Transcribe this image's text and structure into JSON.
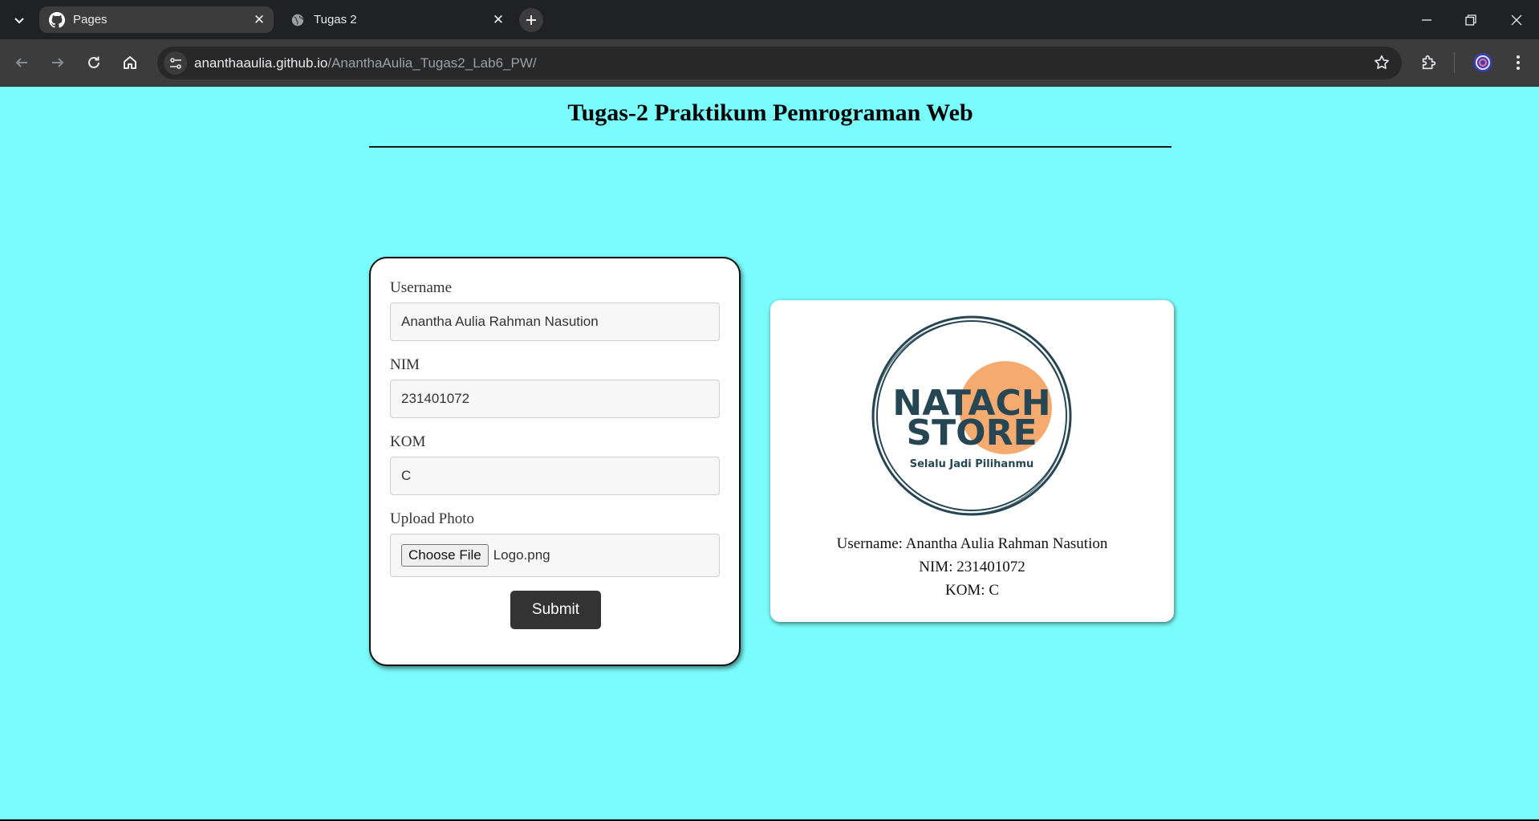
{
  "browser": {
    "tabs": [
      {
        "title": "Pages",
        "icon": "github-icon",
        "active": true
      },
      {
        "title": "Tugas 2",
        "icon": "globe-icon",
        "active": false
      }
    ],
    "url_host": "ananthaaulia.github.io",
    "url_path": "/AnanthaAulia_Tugas2_Lab6_PW/"
  },
  "page": {
    "title": "Tugas-2 Praktikum Pemrograman Web"
  },
  "form": {
    "username_label": "Username",
    "username_value": "Anantha Aulia Rahman Nasution",
    "nim_label": "NIM",
    "nim_value": "231401072",
    "kom_label": "KOM",
    "kom_value": "C",
    "photo_label": "Upload Photo",
    "choose_file_label": "Choose File",
    "file_name": "Logo.png",
    "submit_label": "Submit"
  },
  "result": {
    "logo_text_1": "NATACH",
    "logo_text_2": "STORE",
    "logo_tagline": "Selalu Jadi Pilihanmu",
    "username_line": "Username: Anantha Aulia Rahman Nasution",
    "nim_line": "NIM: 231401072",
    "kom_line": "KOM: C"
  },
  "colors": {
    "page_background": "#7bfcfc",
    "submit_background": "#333333",
    "logo_dark": "#264653",
    "logo_accent": "#f4a261"
  }
}
